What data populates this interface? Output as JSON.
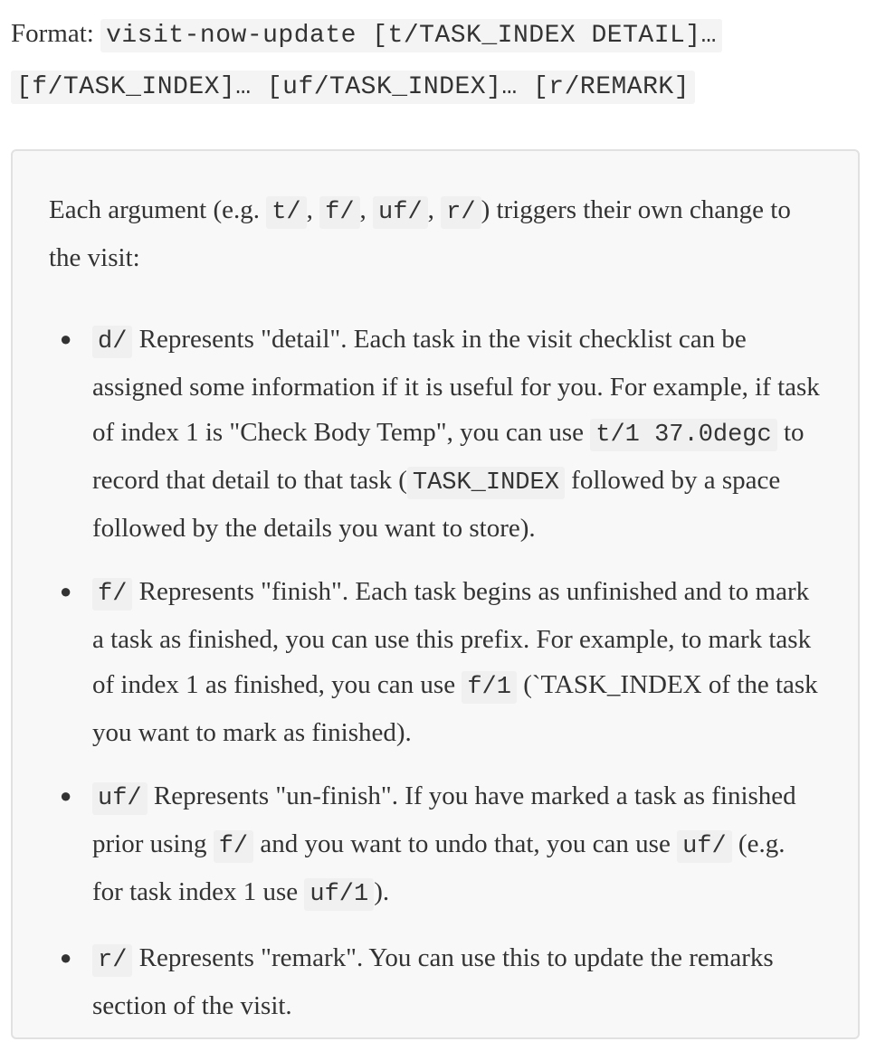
{
  "format": {
    "label": "Format:",
    "command": "visit-now-update [t/TASK_INDEX DETAIL]… [f/TASK_INDEX]… [uf/TASK_INDEX]… [r/REMARK]"
  },
  "intro": {
    "text_1": "Each argument (e.g. ",
    "code_t": "t/",
    "sep_1": ", ",
    "code_f": "f/",
    "sep_2": ", ",
    "code_uf": "uf/",
    "sep_3": ", ",
    "code_r": "r/",
    "text_2": ") triggers their own change to the visit:"
  },
  "args": {
    "detail": {
      "prefix": "d/",
      "text_1": "Represents \"detail\". Each task in the visit checklist can be assigned some information if it is useful for you. For example, if task of index 1 is \"Check Body Temp\", you can use ",
      "code_example": "t/1 37.0degc",
      "text_2": " to record that detail to that task (",
      "code_index": "TASK_INDEX",
      "text_3": " followed by a space followed by the details you want to store)."
    },
    "finish": {
      "prefix": "f/",
      "text_1": "Represents \"finish\". Each task begins as unfinished and to mark a task as finished, you can use this prefix. For example, to mark task of index 1 as finished, you can use ",
      "code_example": "f/1",
      "text_2": " (`TASK_INDEX of the task you want to mark as finished)."
    },
    "unfinish": {
      "prefix": "uf/",
      "text_1": "Represents \"un-finish\". If you have marked a task as finished prior using ",
      "code_f": "f/",
      "text_2": " and you want to undo that, you can use ",
      "code_uf": "uf/",
      "text_3": " (e.g. for task index 1 use ",
      "code_example": "uf/1",
      "text_4": ")."
    },
    "remark": {
      "prefix": "r/",
      "text_1": "Represents \"remark\". You can use this to update the remarks section of the visit."
    }
  }
}
